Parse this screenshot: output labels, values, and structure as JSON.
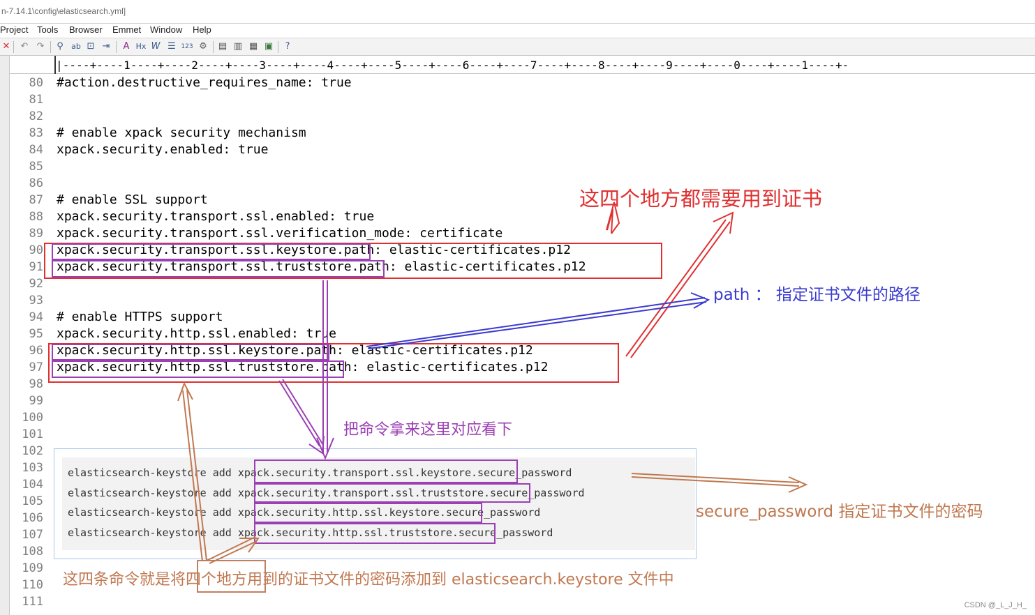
{
  "window": {
    "title": "n-7.14.1\\config\\elasticsearch.yml]"
  },
  "menu": {
    "items": [
      "Project",
      "Tools",
      "Browser",
      "Emmet",
      "Window",
      "Help"
    ]
  },
  "toolbar": {
    "icons": [
      "close-icon",
      "undo-icon",
      "redo-icon",
      "find-icon",
      "replace-icon",
      "find-in-files-icon",
      "indent-icon",
      "font-icon",
      "html-icon",
      "word-wrap-icon",
      "ruler-toggle-icon",
      "line-numbers-icon",
      "settings-icon",
      "panel-1-icon",
      "panel-2-icon",
      "panel-3-icon",
      "panel-4-icon",
      "help-icon"
    ]
  },
  "ruler": {
    "text": "|----+----1----+----2----+----3----+----4----+----5----+----6----+----7----+----8----+----9----+----0----+----1----+-"
  },
  "editor": {
    "line_numbers": [
      "80",
      "81",
      "82",
      "83",
      "84",
      "85",
      "86",
      "87",
      "88",
      "89",
      "90",
      "91",
      "92",
      "93",
      "94",
      "95",
      "96",
      "97",
      "98",
      "99",
      "100",
      "101",
      "102",
      "103",
      "104",
      "105",
      "106",
      "107",
      "108",
      "109",
      "110",
      "111"
    ],
    "lines": {
      "l80": "#action.destructive_requires_name: true",
      "l83": "# enable xpack security mechanism",
      "l84": "xpack.security.enabled: true",
      "l87": "# enable SSL support",
      "l88": "xpack.security.transport.ssl.enabled: true",
      "l89": "xpack.security.transport.ssl.verification_mode: certificate",
      "l90": "xpack.security.transport.ssl.keystore.path: elastic-certificates.p12",
      "l91": "xpack.security.transport.ssl.truststore.path: elastic-certificates.p12",
      "l94": "# enable HTTPS support",
      "l95": "xpack.security.http.ssl.enabled: true",
      "l96": "xpack.security.http.ssl.keystore.path: elastic-certificates.p12",
      "l97": "xpack.security.http.ssl.truststore.path: elastic-certificates.p12"
    }
  },
  "commands": [
    "elasticsearch-keystore add xpack.security.transport.ssl.keystore.secure_password",
    "elasticsearch-keystore add xpack.security.transport.ssl.truststore.secure_password",
    "elasticsearch-keystore add xpack.security.http.ssl.keystore.secure_password",
    "elasticsearch-keystore add xpack.security.http.ssl.truststore.secure_password"
  ],
  "annotations": {
    "four_places": "这四个地方都需要用到证书",
    "path_note": "path ： 指定证书文件的路径",
    "compare_note": "把命令拿来这里对应看下",
    "secure_note": "secure_password 指定证书文件的密码",
    "bottom_note": "这四条命令就是将四个地方用到的证书文件的密码添加到 elasticsearch.keystore 文件中"
  },
  "watermark": "CSDN @_L_J_H_",
  "colors": {
    "red": "#e03030",
    "purple": "#9b40b4",
    "blue": "#3b3bd0",
    "brown": "#c07850"
  }
}
